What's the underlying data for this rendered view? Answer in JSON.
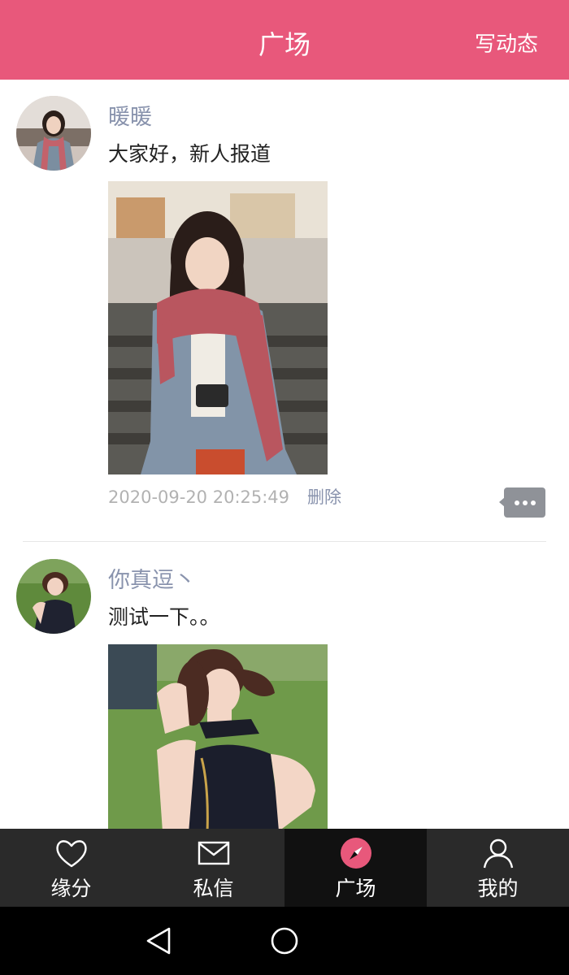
{
  "header": {
    "title": "广场",
    "compose_label": "写动态"
  },
  "posts": [
    {
      "username": "暖暖",
      "content": "大家好，新人报道",
      "timestamp": "2020-09-20 20:25:49",
      "delete_label": "删除"
    },
    {
      "username": "你真逗丶",
      "content": "测试一下。。"
    }
  ],
  "tabbar": {
    "tabs": [
      {
        "label": "缘分",
        "icon": "heart-icon",
        "badge": false,
        "active": false
      },
      {
        "label": "私信",
        "icon": "mail-icon",
        "badge": true,
        "active": false
      },
      {
        "label": "广场",
        "icon": "compass-icon",
        "badge": false,
        "active": true
      },
      {
        "label": "我的",
        "icon": "person-icon",
        "badge": true,
        "active": false
      }
    ]
  },
  "colors": {
    "header_bg": "#e8587b",
    "username": "#8993ad",
    "badge": "#f07a20",
    "tabbar_bg": "#2a2a2a",
    "tab_active_bg": "#111111"
  }
}
